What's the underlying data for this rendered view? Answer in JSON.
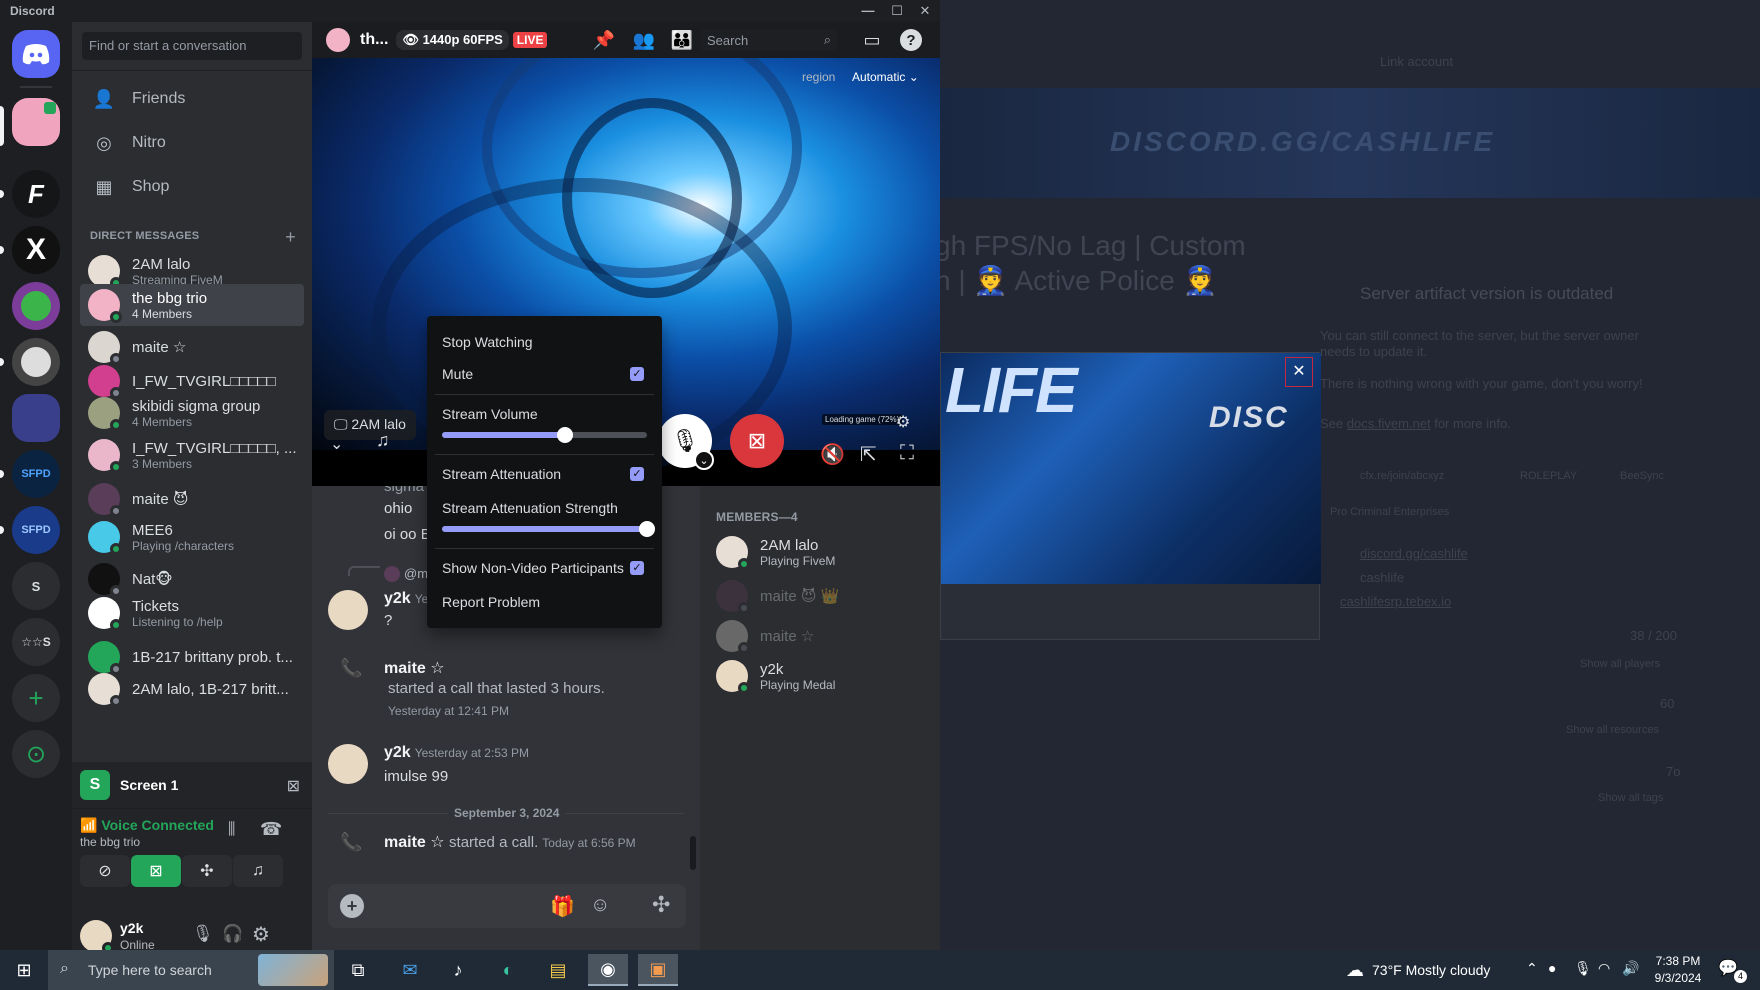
{
  "window": {
    "title": "Discord",
    "controls": {
      "minimize": "—",
      "maximize": "☐",
      "close": "✕"
    }
  },
  "rail": {
    "servers": [
      {
        "name": "home",
        "label": ""
      },
      {
        "name": "server-1",
        "label": ""
      },
      {
        "name": "server-2",
        "label": ""
      },
      {
        "name": "server-3",
        "label": "X"
      },
      {
        "name": "server-4",
        "label": ""
      },
      {
        "name": "server-5",
        "label": ""
      },
      {
        "name": "server-6",
        "label": ""
      },
      {
        "name": "server-7",
        "label": "SFPD"
      },
      {
        "name": "server-8",
        "label": "SFPD"
      },
      {
        "name": "server-9",
        "label": "S"
      },
      {
        "name": "server-10",
        "label": "☆☆S"
      }
    ],
    "add_server": "+",
    "discover": "⊙"
  },
  "sidebar": {
    "search_placeholder": "Find or start a conversation",
    "nav": [
      {
        "label": "Friends",
        "icon": "friends-icon",
        "glyph": "👤"
      },
      {
        "label": "Nitro",
        "icon": "nitro-icon",
        "glyph": "◎"
      },
      {
        "label": "Shop",
        "icon": "shop-icon",
        "glyph": "▦"
      }
    ],
    "dm_header": "DIRECT MESSAGES",
    "dm_add": "+",
    "dms": [
      {
        "name": "2AM lalo",
        "sub": "Streaming FiveM",
        "status": "online",
        "color": "#e7dfd6"
      },
      {
        "name": "the bbg trio",
        "sub": "4 Members",
        "status": "online",
        "color": "#f3b3c6",
        "active": true
      },
      {
        "name": "maite ☆",
        "sub": "",
        "status": "offline",
        "color": "#dcd6d0"
      },
      {
        "name": "I_FW_TVGIRL□□□□□",
        "sub": "",
        "status": "offline",
        "color": "#d13f8e"
      },
      {
        "name": "skibidi sigma group",
        "sub": "4 Members",
        "status": "online",
        "color": "#9aa080"
      },
      {
        "name": "I_FW_TVGIRL□□□□□, ...",
        "sub": "3 Members",
        "status": "online",
        "color": "#e9b7c9"
      },
      {
        "name": "maite 😈",
        "sub": "",
        "status": "offline",
        "color": "#5a3d58"
      },
      {
        "name": "MEE6",
        "sub": "Playing /characters",
        "status": "online",
        "color": "#48c9e8"
      },
      {
        "name": "Nat🐵",
        "sub": "",
        "status": "offline",
        "color": "#111111"
      },
      {
        "name": "Tickets",
        "sub": "Listening to /help",
        "status": "online",
        "color": "#ffffff"
      },
      {
        "name": "1B-217 brittany prob. t...",
        "sub": "",
        "status": "offline",
        "color": "#23a55a"
      },
      {
        "name": "2AM lalo, 1B-217 britt...",
        "sub": "",
        "status": "offline",
        "color": "#e7dfd6"
      }
    ],
    "screen": {
      "label": "Screen 1"
    },
    "voice": {
      "status": "Voice Connected",
      "channel": "the bbg trio"
    },
    "user": {
      "name": "y2k",
      "status": "Online"
    }
  },
  "stream": {
    "title": "th...",
    "quality": "1440p 60FPS",
    "live": "LIVE",
    "search_placeholder": "Search",
    "region_label": "region",
    "region_value": "Automatic",
    "streamer": "2AM lalo",
    "overlay_text": "Loading game (72%)"
  },
  "menu": {
    "stop_watching": "Stop Watching",
    "mute": "Mute",
    "mute_checked": true,
    "stream_volume": "Stream Volume",
    "stream_volume_value": 0.6,
    "stream_attenuation": "Stream Attenuation",
    "stream_attenuation_checked": true,
    "attenuation_strength": "Stream Attenuation Strength",
    "attenuation_strength_value": 1.0,
    "show_non_video": "Show Non-Video Participants",
    "show_non_video_checked": true,
    "report": "Report Problem"
  },
  "chat": {
    "lines_top": [
      "sigma",
      "ohio",
      "oi oo E"
    ],
    "reply_preview": "@m",
    "messages": [
      {
        "author": "y2k",
        "time": "Ye",
        "text": "?"
      },
      {
        "author": "maite ☆",
        "text": "started a call that lasted 3 hours.",
        "time": "Yesterday at 12:41 PM",
        "call": true
      },
      {
        "author": "y2k",
        "time": "Yesterday at 2:53 PM",
        "text": "imulse 99"
      }
    ],
    "date_divider": "September 3, 2024",
    "last_call": {
      "author": "maite ☆",
      "text": "started a call.",
      "time": "Today at 6:56 PM"
    }
  },
  "members": {
    "header": "MEMBERS—4",
    "list": [
      {
        "name": "2AM lalo",
        "sub": "Playing FiveM",
        "status": "online",
        "dim": false
      },
      {
        "name": "maite 😈 👑",
        "sub": "",
        "status": "offline",
        "dim": true
      },
      {
        "name": "maite ☆",
        "sub": "",
        "status": "offline",
        "dim": true
      },
      {
        "name": "y2k",
        "sub": "Playing Medal",
        "status": "online",
        "dim": false
      }
    ]
  },
  "background": {
    "link_account": "Link account",
    "banner": "DISCORD.GG/CASHLIFE",
    "title_line1": "gh FPS/No Lag | Custom",
    "title_line2": "h | 👮 Active Police 👮",
    "warning": "Server artifact version is outdated",
    "warning_sub1": "You can still connect to the server, but the server owner",
    "warning_sub2": "needs to update it.",
    "warning_sub3": "There is nothing wrong with your game, don't you worry!",
    "warning_sub4": "See",
    "warning_link": "docs.fivem.net",
    "warning_sub5": "for more info.",
    "rows": [
      "cfx.re/join/abcxyz",
      "ROLEPLAY",
      "BeeSync",
      "Pro Criminal Enterprises"
    ],
    "links": [
      "discord.gg/cashlife",
      "cashlife",
      "cashlifesrp.tebex.io"
    ],
    "players": "38 / 200",
    "resources": "60",
    "tags": "7o",
    "show_players": "Show all players",
    "show_resources": "Show all resources",
    "show_tags": "Show all tags",
    "popup_text": "LIFE",
    "popup_text2": "DISC",
    "popup_close": "✕"
  },
  "taskbar": {
    "search_placeholder": "Type here to search",
    "weather": "73°F  Mostly cloudy",
    "time": "7:38 PM",
    "date": "9/3/2024",
    "notifications": "4"
  }
}
